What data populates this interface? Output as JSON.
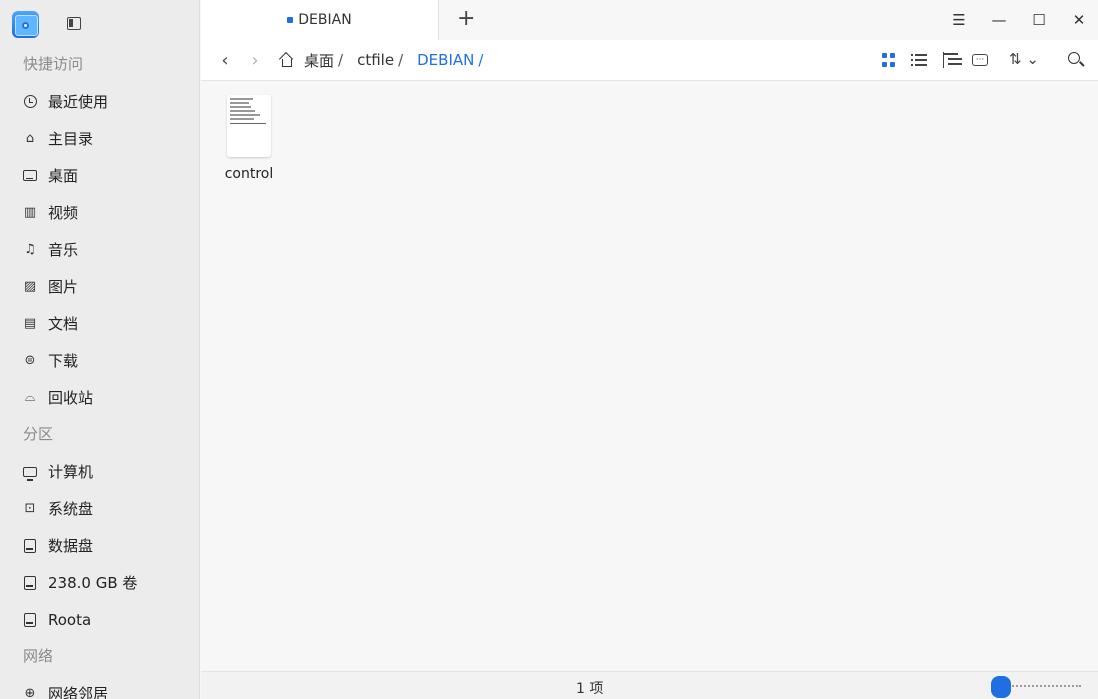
{
  "sidebar": {
    "groups": [
      {
        "title": "快捷访问",
        "items": [
          {
            "label": "最近使用",
            "icon": "clock-icon"
          },
          {
            "label": "主目录",
            "icon": "home-icon"
          },
          {
            "label": "桌面",
            "icon": "desktop-icon"
          },
          {
            "label": "视频",
            "icon": "video-icon"
          },
          {
            "label": "音乐",
            "icon": "music-icon"
          },
          {
            "label": "图片",
            "icon": "picture-icon"
          },
          {
            "label": "文档",
            "icon": "document-icon"
          },
          {
            "label": "下载",
            "icon": "download-icon"
          },
          {
            "label": "回收站",
            "icon": "trash-icon"
          }
        ]
      },
      {
        "title": "分区",
        "items": [
          {
            "label": "计算机",
            "icon": "computer-icon"
          },
          {
            "label": "系统盘",
            "icon": "system-disk-icon"
          },
          {
            "label": "数据盘",
            "icon": "drive-icon"
          },
          {
            "label": "238.0 GB 卷",
            "icon": "drive-icon"
          },
          {
            "label": "Roota",
            "icon": "drive-icon"
          }
        ]
      },
      {
        "title": "网络",
        "items": [
          {
            "label": "网络邻居",
            "icon": "network-icon"
          }
        ]
      }
    ]
  },
  "tabs": [
    {
      "label": "DEBIAN",
      "active": true
    }
  ],
  "breadcrumb": {
    "items": [
      "桌面",
      "ctfile",
      "DEBIAN"
    ],
    "separator": "/"
  },
  "files": [
    {
      "name": "control",
      "type": "text-file"
    }
  ],
  "status": {
    "count": "1 项"
  },
  "colors": {
    "accent": "#1f6fe0",
    "sidebar_bg": "#ececec",
    "content_bg": "#f7f7f7"
  }
}
